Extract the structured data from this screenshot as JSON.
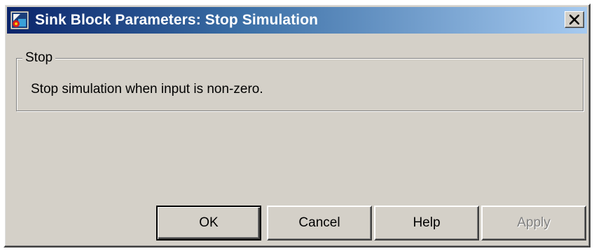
{
  "window": {
    "title": "Sink Block Parameters: Stop Simulation",
    "icon": "simulink-block-icon",
    "close_symbol": "close-icon"
  },
  "group": {
    "label": "Stop",
    "description": "Stop simulation when input is non-zero."
  },
  "buttons": {
    "ok": "OK",
    "cancel": "Cancel",
    "help": "Help",
    "apply": "Apply"
  },
  "colors": {
    "face": "#d4d0c8",
    "title_start": "#0a246a",
    "title_end": "#a6caf0",
    "disabled_text": "#808080"
  }
}
